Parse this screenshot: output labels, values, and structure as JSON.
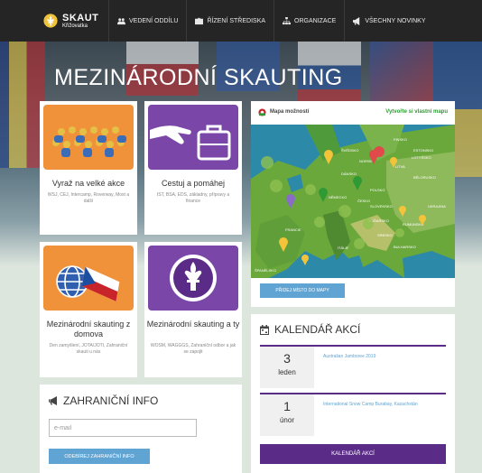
{
  "logo": {
    "name": "SKAUT",
    "subtitle": "Křižovatka"
  },
  "nav": [
    {
      "label": "VEDENÍ ODDÍLU",
      "icon": "group-icon"
    },
    {
      "label": "ŘÍZENÍ STŘEDISKA",
      "icon": "briefcase-icon"
    },
    {
      "label": "ORGANIZACE",
      "icon": "hierarchy-icon"
    },
    {
      "label": "VŠECHNY NOVINKY",
      "icon": "megaphone-icon"
    }
  ],
  "hero": {
    "title": "MEZINÁRODNÍ SKAUTING"
  },
  "cards": [
    {
      "title": "Vyraž na velké akce",
      "subtitle": "WSJ, CEJ, Intercamp, Roverway, Most a další",
      "image": "crowd-icon"
    },
    {
      "title": "Cestuj a pomáhej",
      "subtitle": "IST, BSA, EDS, základny, přípravy a finance",
      "image": "handshake-suitcase-icon"
    },
    {
      "title": "Mezinárodní skauting z domova",
      "subtitle": "Den zamyšlení, JOTA/JOTI, Zahraniční skauti u nás",
      "image": "globe-flag-icon"
    },
    {
      "title": "Mezinárodní skauting a ty",
      "subtitle": "WOSM, WAGGGS, Zahraniční odbor a jak se zapojit",
      "image": "fleur-de-lis-icon"
    }
  ],
  "map": {
    "title": "Mapa možností",
    "link": "Vytvořte si vlastní mapu",
    "button": "PŘIDEJ MÍSTO DO MAPY",
    "labels": [
      "FINSKO",
      "NORSKO",
      "ŠVÉDSKO",
      "ESTONSKO",
      "LOTYŠSKO",
      "LITVA",
      "BĚLORUSKO",
      "POLSKO",
      "NĚMECKO",
      "ČESKO",
      "UKRAJINA",
      "SLOVENSKO",
      "MAĎARSKO",
      "RUMUNSKO",
      "FRANCIE",
      "ITÁLIE",
      "BULHARSKO",
      "ŠPANĚLSKO",
      "SRBSKO",
      "DÁNSKO"
    ]
  },
  "calendar": {
    "title": "KALENDÁŘ AKCÍ",
    "events": [
      {
        "day": "3",
        "month": "leden",
        "name": "Australian Jamboree 2019"
      },
      {
        "day": "1",
        "month": "únor",
        "name": "International Snow Camp Burabay, Kazachstán"
      }
    ],
    "button": "KALENDÁŘ AKCÍ"
  },
  "foreign_info": {
    "title": "ZAHRANIČNÍ INFO",
    "placeholder": "e-mail",
    "button": "ODEBÍREJ ZAHRANIČNÍ INFO"
  },
  "colors": {
    "nav_bg": "#252525",
    "purple": "#5b2c87",
    "blue_button": "#5fa4d3",
    "orange_card": "#f0923a",
    "purple_card": "#7a46a8",
    "map_link_green": "#2f9a34"
  }
}
